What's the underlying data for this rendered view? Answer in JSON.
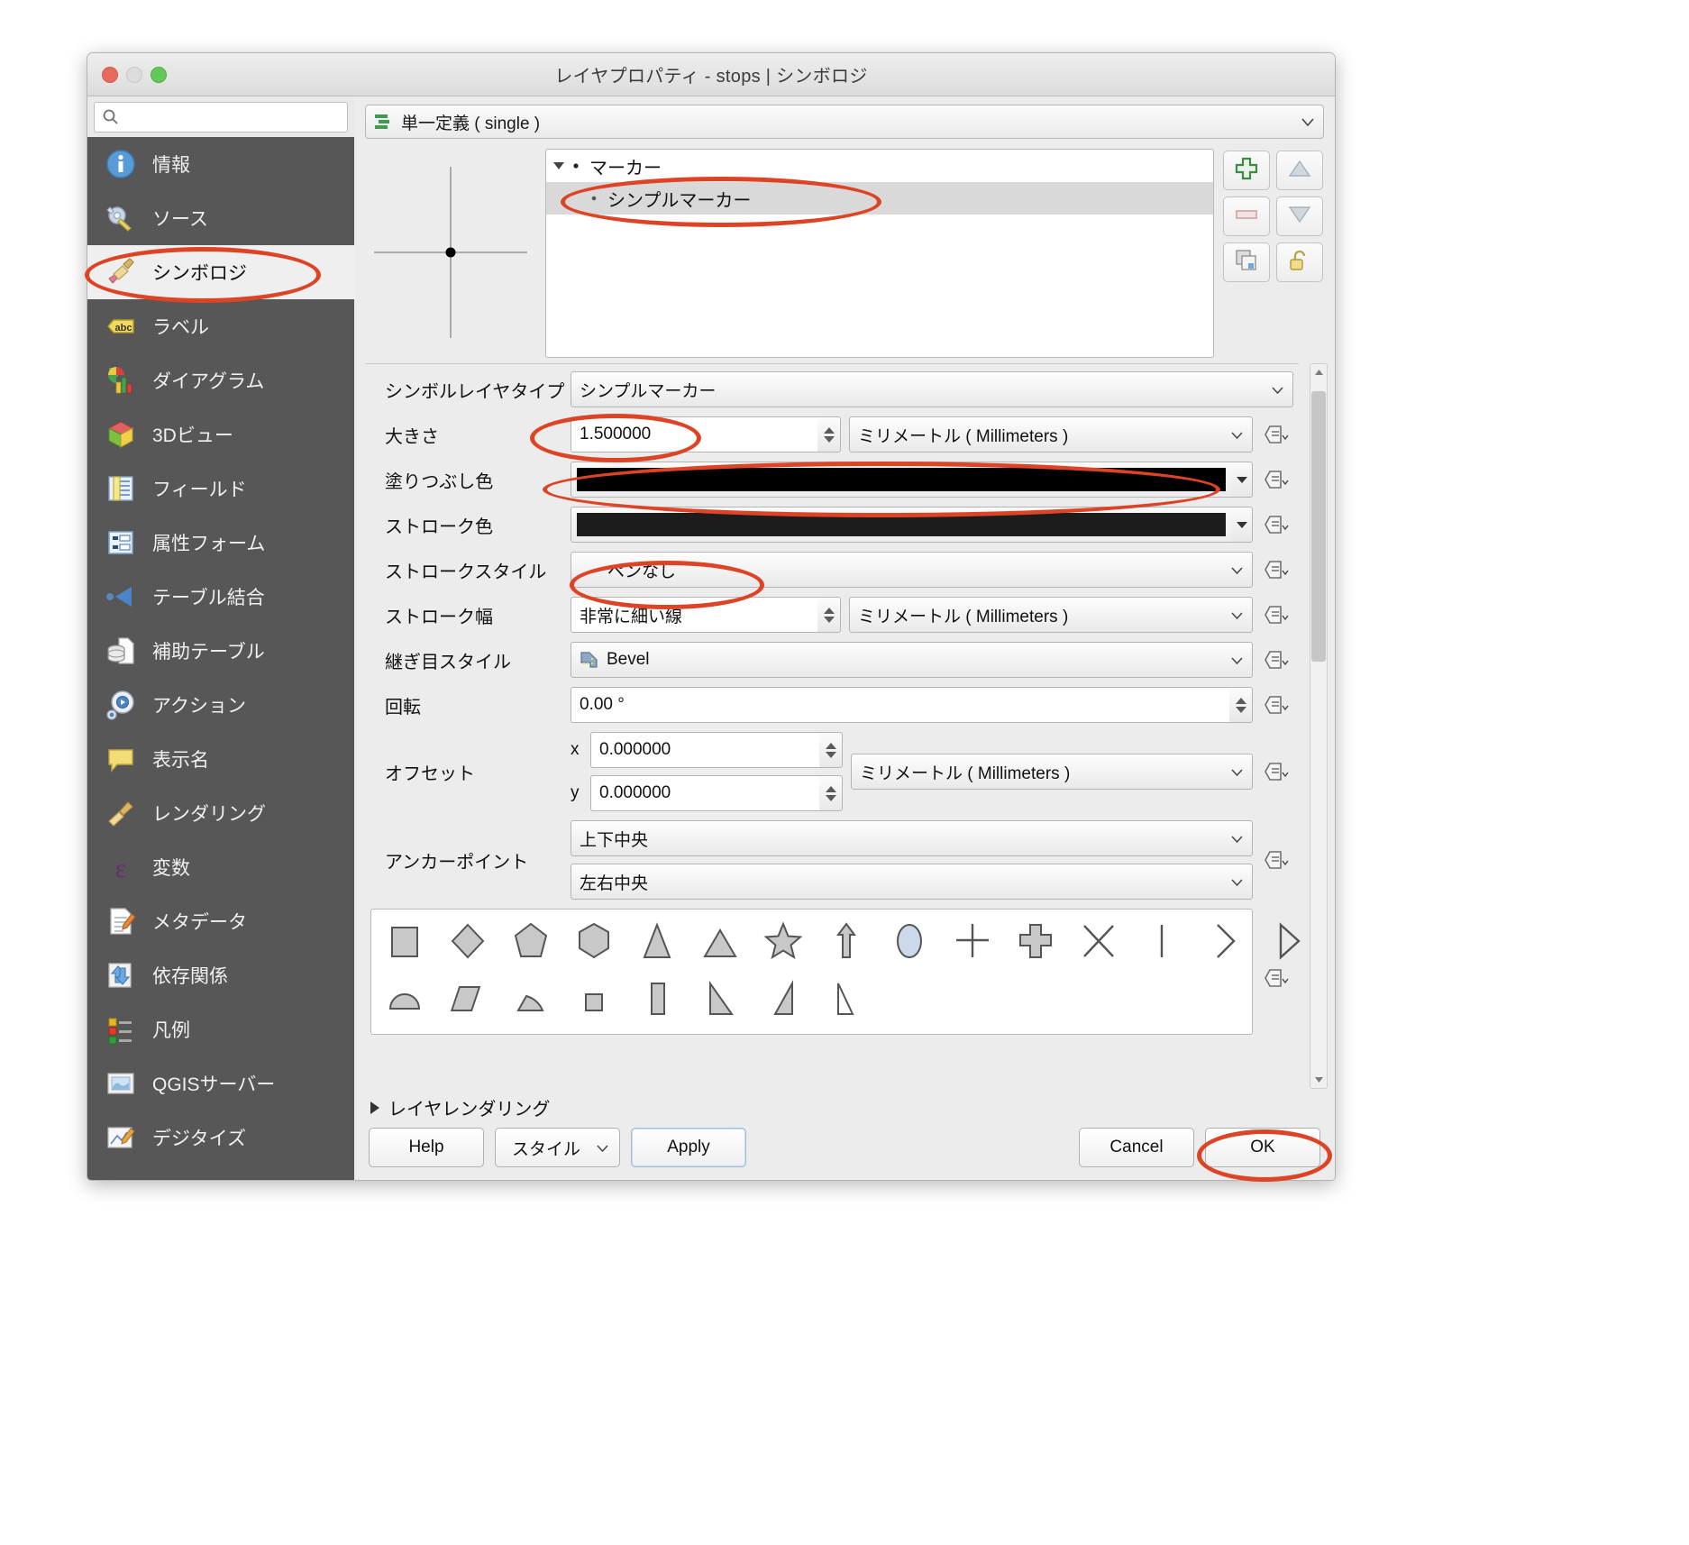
{
  "window": {
    "title": "レイヤプロパティ - stops | シンボロジ",
    "traffic_lights": [
      "close",
      "minimize",
      "zoom"
    ]
  },
  "search": {
    "value": "",
    "placeholder": ""
  },
  "sidebar": {
    "items": [
      {
        "label": "情報",
        "icon": "info-icon"
      },
      {
        "label": "ソース",
        "icon": "source-icon"
      },
      {
        "label": "シンボロジ",
        "icon": "symbology-icon",
        "active": true
      },
      {
        "label": "ラベル",
        "icon": "labels-icon"
      },
      {
        "label": "ダイアグラム",
        "icon": "diagram-icon"
      },
      {
        "label": "3Dビュー",
        "icon": "cube-icon"
      },
      {
        "label": "フィールド",
        "icon": "fields-icon"
      },
      {
        "label": "属性フォーム",
        "icon": "attribute-form-icon"
      },
      {
        "label": "テーブル結合",
        "icon": "joins-icon"
      },
      {
        "label": "補助テーブル",
        "icon": "auxiliary-storage-icon"
      },
      {
        "label": "アクション",
        "icon": "actions-icon"
      },
      {
        "label": "表示名",
        "icon": "display-icon"
      },
      {
        "label": "レンダリング",
        "icon": "rendering-icon"
      },
      {
        "label": "変数",
        "icon": "variables-icon"
      },
      {
        "label": "メタデータ",
        "icon": "metadata-icon"
      },
      {
        "label": "依存関係",
        "icon": "dependencies-icon"
      },
      {
        "label": "凡例",
        "icon": "legend-icon"
      },
      {
        "label": "QGISサーバー",
        "icon": "qgis-server-icon"
      },
      {
        "label": "デジタイズ",
        "icon": "digitizing-icon"
      }
    ]
  },
  "renderer": {
    "label": "単一定義 ( single )",
    "icon": "single-symbol-icon"
  },
  "symbol_tree": {
    "rows": [
      {
        "label": "マーカー",
        "level": 0,
        "expanded": true
      },
      {
        "label": "シンプルマーカー",
        "level": 1,
        "selected": true
      }
    ],
    "tools": [
      {
        "name": "add-symbol-layer-button",
        "icon": "plus-icon"
      },
      {
        "name": "move-up-button",
        "icon": "triangle-up-icon"
      },
      {
        "name": "remove-symbol-layer-button",
        "icon": "minus-icon"
      },
      {
        "name": "move-down-button",
        "icon": "triangle-down-icon"
      },
      {
        "name": "duplicate-button",
        "icon": "copy-icon"
      },
      {
        "name": "lock-button",
        "icon": "unlock-icon"
      }
    ]
  },
  "form": {
    "symbol_layer_type": {
      "label": "シンボルレイヤタイプ",
      "value": "シンプルマーカー"
    },
    "size": {
      "label": "大きさ",
      "value": "1.500000",
      "unit": "ミリメートル ( Millimeters )"
    },
    "fill_color": {
      "label": "塗りつぶし色",
      "value": "#000000"
    },
    "stroke_color": {
      "label": "ストローク色",
      "value": "#1c1c1c"
    },
    "stroke_style": {
      "label": "ストロークスタイル",
      "value": "ペンなし"
    },
    "stroke_width": {
      "label": "ストローク幅",
      "value": "非常に細い線",
      "unit": "ミリメートル ( Millimeters )"
    },
    "join_style": {
      "label": "継ぎ目スタイル",
      "value": "Bevel",
      "icon": "bevel-join-icon"
    },
    "rotation": {
      "label": "回転",
      "value": "0.00 °"
    },
    "offset": {
      "label": "オフセット",
      "x_label": "x",
      "x_value": "0.000000",
      "y_label": "y",
      "y_value": "0.000000",
      "unit": "ミリメートル ( Millimeters )"
    },
    "anchor_point": {
      "label": "アンカーポイント",
      "vertical": "上下中央",
      "horizontal": "左右中央"
    },
    "shapes_row1": [
      "square",
      "diamond",
      "pentagon",
      "hexagon",
      "triangle",
      "equilateral-triangle",
      "star",
      "arrow",
      "circle",
      "cross",
      "cross-fill",
      "x-mark",
      "line",
      "half-arc",
      "right-triangle-arrow"
    ],
    "shapes_row2": [
      "half-circle",
      "parallelogram",
      "quarter-circle",
      "small-square",
      "half-square",
      "diagonal-half-square",
      "right-half-triangle",
      "left-half-triangle"
    ]
  },
  "footer": {
    "layer_rendering": "レイヤレンダリング",
    "help": "Help",
    "style": "スタイル",
    "apply": "Apply",
    "cancel": "Cancel",
    "ok": "OK"
  },
  "annotations": {
    "accent_color": "#dd4425",
    "highlighted": [
      "シンボロジ",
      "シンプルマーカー",
      "1.500000",
      "塗りつぶし色",
      "ペンなし",
      "OK"
    ]
  }
}
